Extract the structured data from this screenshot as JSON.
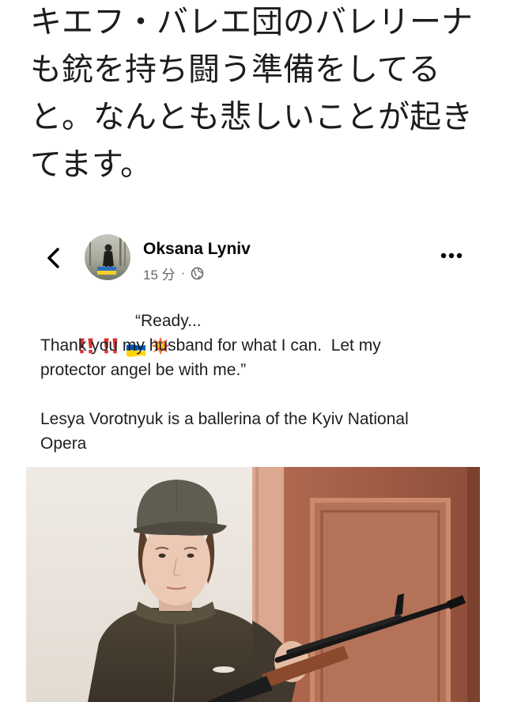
{
  "headline": {
    "lines": [
      "キエフ・バレエ団のバレリーナ",
      "も銃を持ち闘う準備をしてる",
      "と。なんとも悲しいことが起き",
      "てます。"
    ]
  },
  "post": {
    "icons": {
      "back": "chevron-left-icon",
      "more": "more-horizontal-icon",
      "privacy": "globe-icon"
    },
    "author": "Oksana Lyniv",
    "time": "15 分",
    "separator": "·",
    "emoji": [
      "double-exclamation-icon",
      "double-exclamation-icon",
      "ukraine-flag-icon",
      "collision-icon"
    ],
    "quote_lines": [
      "“Ready...",
      "Thank you my husband for what I can.  Let my",
      "protector angel be with me.”"
    ],
    "caption_lines": [
      "Lesya Vorotnyuk is a ballerina of the Kyiv National",
      "Opera"
    ]
  },
  "colors": {
    "text": "#1c1e21",
    "meta": "#65676b",
    "exclamation_red": "#e0312b",
    "flag_blue": "#0057b7",
    "flag_yellow": "#ffd500"
  }
}
